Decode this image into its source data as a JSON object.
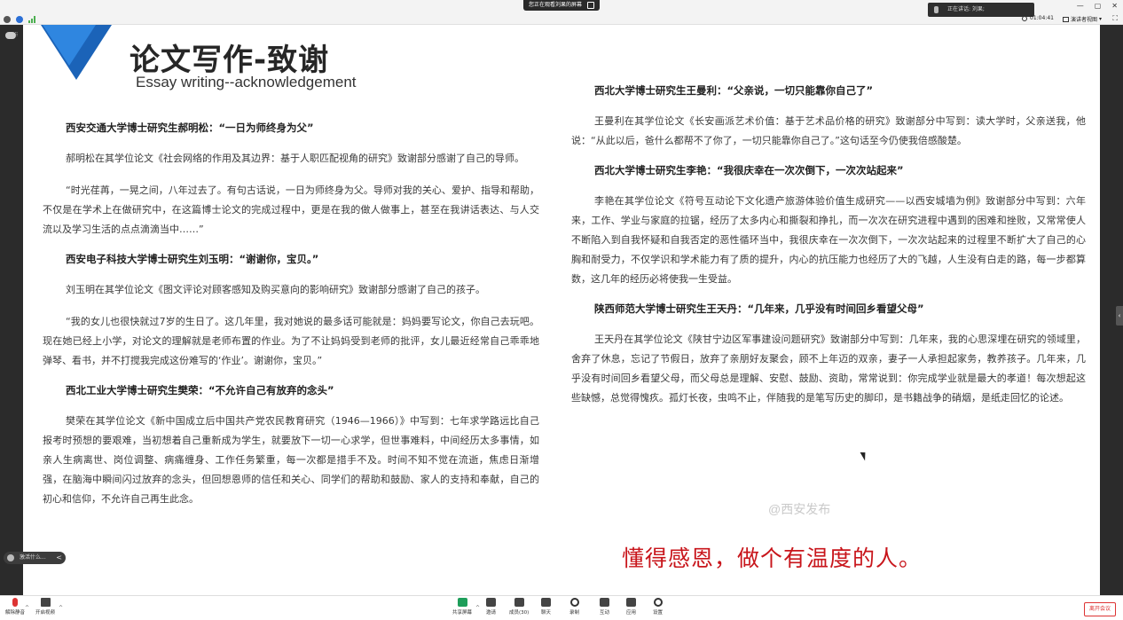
{
  "top_bar": {
    "share_notice": "您正在观看刘果的屏幕",
    "speaking": "正在讲话: 刘果;",
    "timer": "01:04:41",
    "view_mode": "演讲者视图",
    "window_controls": [
      "—",
      "▢",
      "✕"
    ],
    "fullscreen": "⛶"
  },
  "left_rail": {
    "hint": "⠿"
  },
  "floating_label": {
    "text": "激活什么...",
    "chevron": "<"
  },
  "right_tab": {
    "chevron": "‹"
  },
  "slide": {
    "title_cn": "论文写作-致谢",
    "title_en": "Essay writing--acknowledgement",
    "left_column": [
      {
        "type": "heading",
        "text": "西安交通大学博士研究生郝明松：“一日为师终身为父”"
      },
      {
        "type": "para",
        "text": "郝明松在其学位论文《社会网络的作用及其边界：基于人职匹配视角的研究》致谢部分感谢了自己的导师。"
      },
      {
        "type": "para",
        "text": "“时光荏苒，一晃之间，八年过去了。有句古话说，一日为师终身为父。导师对我的关心、爱护、指导和帮助，不仅是在学术上在做研究中，在这篇博士论文的完成过程中，更是在我的做人做事上，甚至在我讲话表达、与人交流以及学习生活的点点滴滴当中……”"
      },
      {
        "type": "heading",
        "text": "西安电子科技大学博士研究生刘玉明：“谢谢你，宝贝。”"
      },
      {
        "type": "para",
        "text": "刘玉明在其学位论文《图文评论对顾客感知及购买意向的影响研究》致谢部分感谢了自己的孩子。"
      },
      {
        "type": "para",
        "text": "“我的女儿也很快就过7岁的生日了。这几年里，我对她说的最多话可能就是：妈妈要写论文，你自己去玩吧。现在她已经上小学，对论文的理解就是老师布置的作业。为了不让妈妈受到老师的批评，女儿最近经常自己乖乖地弹琴、看书，并不打搅我完成这份难写的‘作业’。谢谢你，宝贝。”"
      },
      {
        "type": "heading",
        "text": "西北工业大学博士研究生樊荣：“不允许自己有放弃的念头”"
      },
      {
        "type": "para",
        "text": "樊荣在其学位论文《新中国成立后中国共产党农民教育研究（1946—1966）》中写到：七年求学路远比自己报考时预想的要艰难，当初想着自己重新成为学生，就要放下一切一心求学，但世事难料，中间经历太多事情，如亲人生病离世、岗位调整、病痛缠身、工作任务繁重，每一次都是措手不及。时间不知不觉在流逝，焦虑日渐增强，在脑海中瞬间闪过放弃的念头，但回想恩师的信任和关心、同学们的帮助和鼓励、家人的支持和奉献，自己的初心和信仰，不允许自己再生此念。"
      }
    ],
    "right_column": [
      {
        "type": "heading",
        "text": "西北大学博士研究生王曼利：“父亲说，一切只能靠你自己了”"
      },
      {
        "type": "para",
        "text": "王曼利在其学位论文《长安画派艺术价值：基于艺术品价格的研究》致谢部分中写到：读大学时，父亲送我，他说：“从此以后，爸什么都帮不了你了，一切只能靠你自己了。”这句话至今仍使我倍感酸楚。"
      },
      {
        "type": "heading",
        "text": "西北大学博士研究生李艳：“我很庆幸在一次次倒下，一次次站起来”"
      },
      {
        "type": "para",
        "text": "李艳在其学位论文《符号互动论下文化遗产旅游体验价值生成研究——以西安城墙为例》致谢部分中写到：六年来，工作、学业与家庭的拉锯，经历了太多内心和撕裂和挣扎，而一次次在研究进程中遇到的困难和挫败，又常常使人不断陷入到自我怀疑和自我否定的恶性循环当中，我很庆幸在一次次倒下，一次次站起来的过程里不断扩大了自己的心胸和耐受力，不仅学识和学术能力有了质的提升，内心的抗压能力也经历了大的飞越，人生没有白走的路，每一步都算数，这几年的经历必将使我一生受益。"
      },
      {
        "type": "heading",
        "text": "陕西师范大学博士研究生王天丹：“几年来，几乎没有时间回乡看望父母”"
      },
      {
        "type": "para",
        "text": "王天丹在其学位论文《陕甘宁边区军事建设问题研究》致谢部分中写到：几年来，我的心思深埋在研究的领域里，舍弃了休息，忘记了节假日，放弃了亲朋好友聚会，顾不上年迈的双亲，妻子一人承担起家务，教养孩子。几年来，几乎没有时间回乡看望父母，而父母总是理解、安慰、鼓励、资助，常常说到：你完成学业就是最大的孝道！每次想起这些缺憾，总觉得愧疚。孤灯长夜，虫鸣不止，伴随我的是笔写历史的脚印，是书籍战争的硝烟，是纸走回忆的论述。"
      }
    ],
    "slogan": "懂得感恩，做个有温度的人。",
    "watermark": "@西安发布"
  },
  "toolbar": {
    "items": [
      {
        "id": "mute",
        "label": "解除静音"
      },
      {
        "id": "video",
        "label": "开启视频"
      },
      {
        "id": "share",
        "label": "共享屏幕"
      },
      {
        "id": "invite",
        "label": "邀请"
      },
      {
        "id": "members",
        "label": "成员(30)"
      },
      {
        "id": "chat",
        "label": "聊天"
      },
      {
        "id": "record",
        "label": "录制"
      },
      {
        "id": "reactions",
        "label": "互动"
      },
      {
        "id": "apps",
        "label": "应用"
      },
      {
        "id": "settings",
        "label": "设置"
      }
    ],
    "end_meeting": "离开会议",
    "colors": {
      "end": "#d33333",
      "share": "#1e9e5a"
    }
  }
}
